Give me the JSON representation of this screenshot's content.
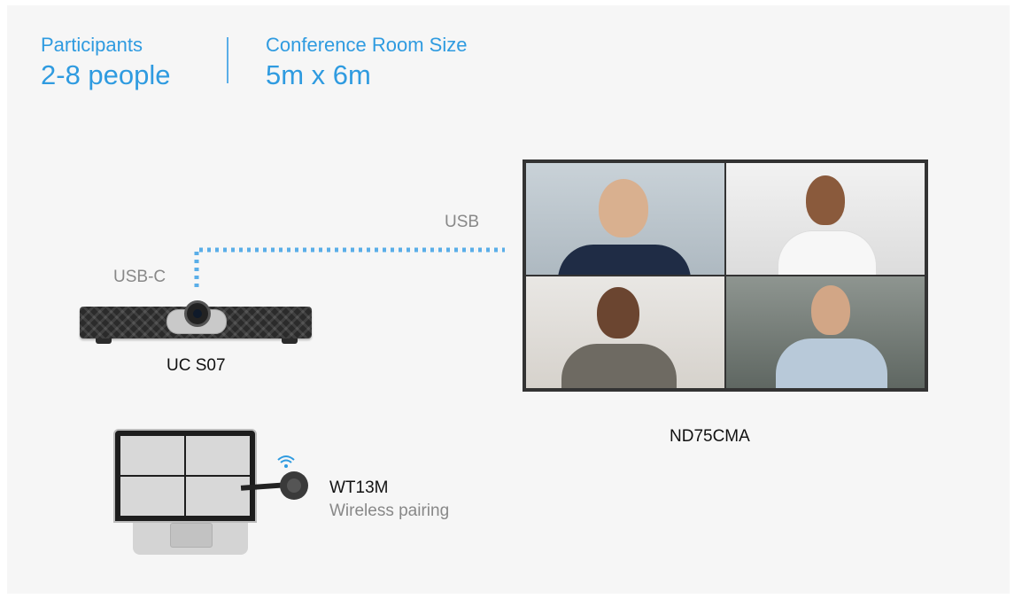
{
  "header": {
    "participants": {
      "label": "Participants",
      "value": "2-8 people"
    },
    "room": {
      "label": "Conference Room Size",
      "value": "5m x 6m"
    }
  },
  "connections": {
    "usb_c": "USB-C",
    "usb": "USB"
  },
  "devices": {
    "soundbar": "UC S07",
    "display": "ND75CMA",
    "dongle": {
      "name": "WT13M",
      "description": "Wireless pairing"
    }
  },
  "colors": {
    "accent": "#2f9be0",
    "link": "#5aaee8"
  }
}
